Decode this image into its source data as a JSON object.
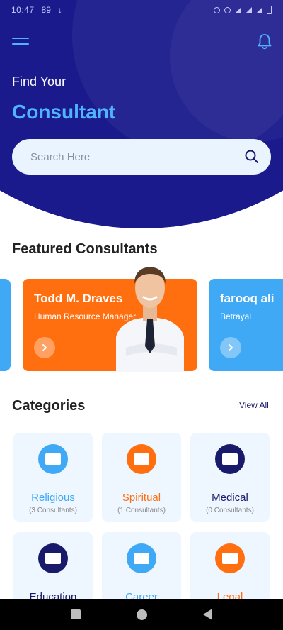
{
  "statusbar": {
    "time": "10:47",
    "extra": "89"
  },
  "header": {
    "title_line1": "Find Your",
    "title_line2": "Consultant",
    "search_placeholder": "Search Here"
  },
  "featured": {
    "title": "Featured Consultants",
    "cards": [
      {
        "name": "Todd M. Draves",
        "tagline": "Human Resource Manager",
        "color": "#ff6f0f"
      },
      {
        "name": "farooq ali",
        "tagline": "Betrayal",
        "color": "#3fa9f5"
      }
    ]
  },
  "categories": {
    "title": "Categories",
    "view_all": "View All",
    "items": [
      {
        "name": "Religious",
        "count": "(3 Consultants)",
        "color": "#3fa9f5"
      },
      {
        "name": "Spiritual",
        "count": "(1 Consultants)",
        "color": "#ff6f0f"
      },
      {
        "name": "Medical",
        "count": "(0 Consultants)",
        "color": "#1a1a6b"
      },
      {
        "name": "Education",
        "count": "",
        "color": "#1a1a6b"
      },
      {
        "name": "Career",
        "count": "",
        "color": "#3fa9f5"
      },
      {
        "name": "Legal",
        "count": "",
        "color": "#ff6f0f"
      }
    ]
  },
  "colors": {
    "primary": "#1a1a8c",
    "accent": "#4fb3ff",
    "orange": "#ff6f0f"
  }
}
